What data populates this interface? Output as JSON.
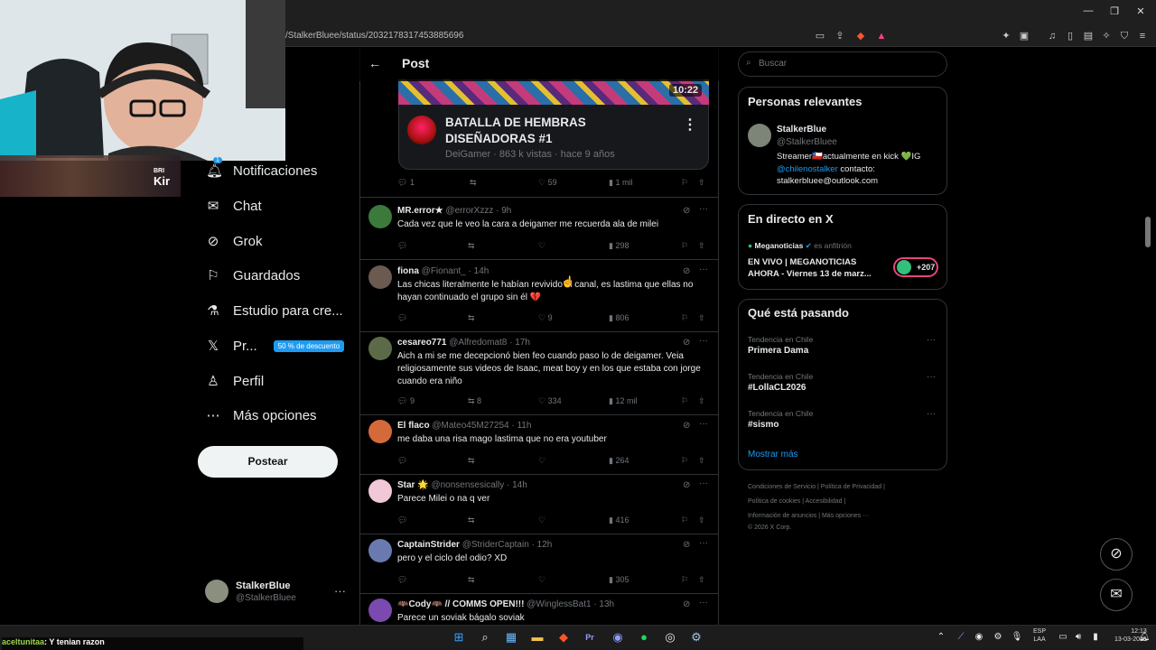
{
  "browser": {
    "url": "/StalkerBluee/status/2032178317453885696"
  },
  "stream_overlay": {
    "strip_text_1": "BRI",
    "strip_text_2": "Kir",
    "chat_user": "aceltunitaa",
    "chat_message": ": Y tenian razon"
  },
  "left_nav": {
    "items": [
      {
        "label": "Notificaciones",
        "icon": "bell-icon",
        "badge": "1"
      },
      {
        "label": "Chat",
        "icon": "mail-icon"
      },
      {
        "label": "Grok",
        "icon": "grok-icon"
      },
      {
        "label": "Guardados",
        "icon": "bookmark-icon"
      },
      {
        "label": "Estudio para cre...",
        "icon": "flask-icon"
      },
      {
        "label": "Pr...",
        "icon": "x-logo-icon",
        "promo": "50 % de descuento"
      },
      {
        "label": "Perfil",
        "icon": "person-icon"
      },
      {
        "label": "Más opciones",
        "icon": "more-circle-icon"
      }
    ],
    "post_button": "Postear",
    "account": {
      "name": "StalkerBlue",
      "handle": "@StalkerBluee"
    }
  },
  "post": {
    "header": "Post",
    "video_duration": "10:22",
    "card": {
      "title": "BATALLA DE HEMBRAS DISEÑADORAS #1",
      "meta": "DeiGamer · 863 k vistas · hace 9 años"
    },
    "actions": {
      "replies": "1",
      "likes": "59",
      "views": "1 mil"
    }
  },
  "replies": [
    {
      "name": "MR.error★",
      "handle": "@errorXzzz · 9h",
      "text": "Cada vez que le veo la cara a deigamer me recuerda ala de milei",
      "replies": "",
      "reposts": "",
      "likes": "",
      "views": "298"
    },
    {
      "name": "fiona",
      "handle": "@Fionant_ · 14h",
      "text": "Las chicas literalmente le habían revivido el canal, es lastima que ellas no hayan continuado el grupo sin él 💔",
      "replies": "",
      "reposts": "",
      "likes": "9",
      "views": "806"
    },
    {
      "name": "cesareo771",
      "handle": "@Alfredomat8 · 17h",
      "text": "Aich a mi se me decepcionó bien feo cuando paso lo de deigamer. Veia religiosamente sus videos de Isaac, meat boy y en los que estaba con jorge cuando era niño",
      "replies": "9",
      "reposts": "8",
      "likes": "334",
      "views": "12 mil"
    },
    {
      "name": "El flaco",
      "handle": "@Mateo45M27254 · 11h",
      "text": "me daba una risa mago lastima que no era youtuber",
      "replies": "",
      "reposts": "",
      "likes": "",
      "views": "264"
    },
    {
      "name": "Star 🌟",
      "handle": "@nonsensesically · 14h",
      "text": "Parece Milei o na q ver",
      "replies": "",
      "reposts": "",
      "likes": "",
      "views": "416"
    },
    {
      "name": "CaptainStrider",
      "handle": "@StriderCaptain · 12h",
      "text": "pero y el ciclo del odio? XD",
      "replies": "",
      "reposts": "",
      "likes": "",
      "views": "305"
    },
    {
      "name": "🦇Cody🦇 // COMMS OPEN!!!",
      "handle": "@WinglessBat1 · 13h",
      "text": "Parece un soviak bágalo soviak",
      "replies": "",
      "reposts": "",
      "likes": "",
      "views": ""
    }
  ],
  "right": {
    "search_placeholder": "Buscar",
    "relevant": {
      "title": "Personas relevantes",
      "name": "StalkerBlue",
      "handle": "@StalkerBluee",
      "bio_1": "Streamer🇨🇱actualmente en kick 💚IG",
      "bio_mention": "@chilenostalker",
      "bio_2": " contacto:",
      "bio_3": "stalkerbluee@outlook.com"
    },
    "live": {
      "title": "En directo en X",
      "host": "Meganoticias",
      "host_suffix": "es anfitrión",
      "text": "EN VIVO | MEGANOTICIAS AHORA - Viernes 13 de marz...",
      "count": "+207"
    },
    "trends": {
      "title": "Qué está pasando",
      "items": [
        {
          "category": "Tendencia en Chile",
          "name": "Primera Dama"
        },
        {
          "category": "Tendencia en Chile",
          "name": "#LollaCL2026"
        },
        {
          "category": "Tendencia en Chile",
          "name": "#sismo"
        }
      ],
      "show_more": "Mostrar más"
    },
    "footer": {
      "line1": "Condiciones de Servicio  |  Política de Privacidad  |",
      "line2": "Política de cookies  |  Accesibilidad  |",
      "line3": "Información de anuncios  |  Más opciones ···",
      "line4": "© 2026 X Corp."
    }
  },
  "taskbar": {
    "lang_1": "ESP",
    "lang_2": "LAA",
    "time": "12:13",
    "date": "13-03-2026"
  },
  "colors": {
    "accent": "#1d9bf0",
    "background": "#000000",
    "border": "#2f3336",
    "muted": "#71767b"
  }
}
